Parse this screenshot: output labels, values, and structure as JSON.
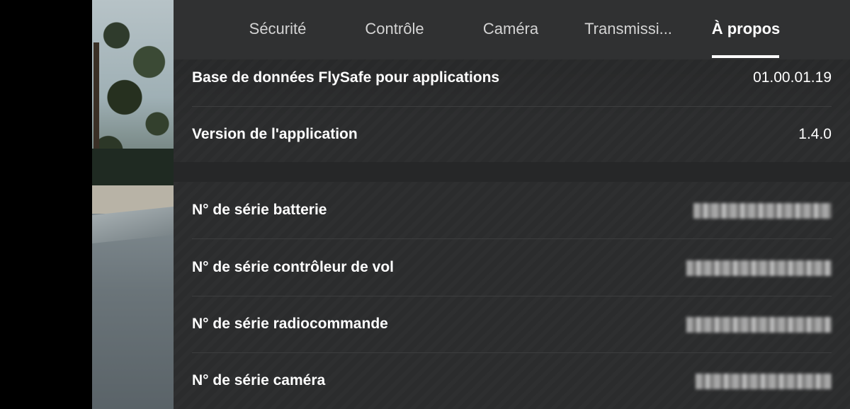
{
  "tabs": [
    {
      "label": "Sécurité",
      "active": false
    },
    {
      "label": "Contrôle",
      "active": false
    },
    {
      "label": "Caméra",
      "active": false
    },
    {
      "label": "Transmissi...",
      "active": false
    },
    {
      "label": "À propos",
      "active": true
    }
  ],
  "rows": [
    {
      "label": "Base de données FlySafe pour applications",
      "value": "01.00.01.19"
    },
    {
      "label": "Version de l'application",
      "value": "1.4.0"
    },
    {
      "label": "N° de série batterie",
      "value": ""
    },
    {
      "label": "N° de série contrôleur de vol",
      "value": ""
    },
    {
      "label": "N° de série radiocommande",
      "value": ""
    },
    {
      "label": "N° de série caméra",
      "value": ""
    }
  ],
  "colors": {
    "panel_background": "#2b2c2d",
    "text": "#ffffff",
    "tab_inactive": "#d4d4d4",
    "active_indicator": "#ffffff"
  }
}
